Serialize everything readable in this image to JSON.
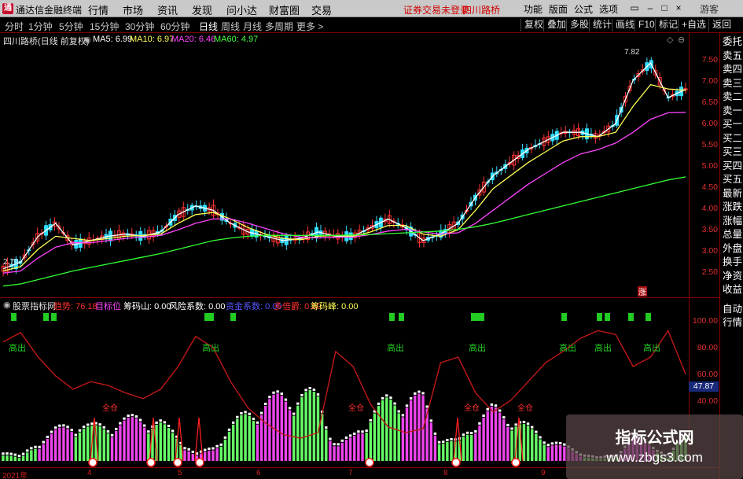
{
  "titlebar": {
    "app_name": "通达信金融终端",
    "menus": [
      "行情",
      "市场",
      "资讯",
      "发现",
      "问小达",
      "财富圈",
      "交易"
    ],
    "notice": "证券交易未登录",
    "stock": "四川路桥",
    "right_menus": [
      "功能",
      "版面",
      "公式",
      "选项"
    ],
    "window_buttons": [
      "▭",
      "–",
      "□",
      "×"
    ]
  },
  "toolbar": {
    "periods": [
      "分时",
      "1分钟",
      "5分钟",
      "15分钟",
      "30分钟",
      "60分钟",
      "日线",
      "周线",
      "月线",
      "多周期",
      "更多 >"
    ],
    "active_period": "日线",
    "right_buttons": [
      "复权",
      "叠加",
      "多股",
      "统计",
      "画线",
      "F10",
      "标记",
      "+自选",
      "返回"
    ]
  },
  "main_chart": {
    "title": "四川路桥(日线 前复权)",
    "indicators": [
      {
        "label": "MA5: 6.99",
        "color": "#ffffff"
      },
      {
        "label": "MA10: 6.97",
        "color": "#ffff55"
      },
      {
        "label": "MA20: 6.46",
        "color": "#ff44ff"
      },
      {
        "label": "MA60: 4.97",
        "color": "#44ff44"
      }
    ],
    "high_label": "7.82",
    "low_label": "2.79",
    "y_ticks": [
      "7.50",
      "7.00",
      "6.50",
      "6.00",
      "5.50",
      "5.00",
      "4.50",
      "4.00",
      "3.50",
      "3.00",
      "2.50"
    ],
    "marker": "涨"
  },
  "sub_chart": {
    "title": "股票指标网",
    "indicators": [
      {
        "label": "趋势: 76.18",
        "color": "#ff3030"
      },
      {
        "label": "目标位",
        "color": "#ff44ff"
      },
      {
        "label": "筹码山: 0.00",
        "color": "#ffffff"
      },
      {
        "label": "风险系数: 0.00",
        "color": "#ffffff"
      },
      {
        "label": "资金系数: 0.00",
        "color": "#5555ff"
      },
      {
        "label": "多倍爵: 0.00",
        "color": "#ff3030"
      },
      {
        "label": "筹码峰: 0.00",
        "color": "#ffff55"
      }
    ],
    "y_ticks": [
      "100.00",
      "80.00",
      "60.00",
      "40.00"
    ],
    "current_value": "47.87",
    "signal_texts": {
      "sell": "高出",
      "buy": "全仓"
    }
  },
  "x_axis": [
    "2021年",
    "4",
    "5",
    "6",
    "7",
    "8",
    "9"
  ],
  "right_panel": [
    "委托",
    "卖五",
    "卖四",
    "卖三",
    "卖二",
    "卖一",
    "买一",
    "买二",
    "买三",
    "买四",
    "买五",
    "最新",
    "涨跌",
    "涨幅",
    "总量",
    "外盘",
    "换手",
    "净资",
    "收益",
    "自动",
    "行情"
  ],
  "watermark": {
    "line1": "指标公式网",
    "line2": "www.zbgs3.com"
  },
  "chart_data": [
    {
      "type": "line",
      "title": "四川路桥(日线 前复权)",
      "ylim": [
        2.3,
        8.0
      ],
      "series": [
        {
          "name": "MA5",
          "values": [
            2.85,
            3.0,
            3.6,
            3.9,
            3.4,
            3.5,
            3.6,
            3.65,
            3.6,
            3.7,
            4.1,
            4.3,
            4.2,
            3.9,
            3.7,
            3.6,
            3.5,
            3.55,
            3.7,
            3.6,
            3.6,
            3.8,
            4.0,
            3.8,
            3.5,
            3.65,
            3.9,
            4.5,
            5.0,
            5.3,
            5.6,
            5.8,
            6.0,
            6.0,
            5.9,
            6.2,
            7.2,
            7.6,
            6.8,
            6.99
          ]
        },
        {
          "name": "MA10",
          "values": [
            2.8,
            2.9,
            3.3,
            3.6,
            3.55,
            3.5,
            3.55,
            3.6,
            3.62,
            3.65,
            3.9,
            4.1,
            4.15,
            4.0,
            3.8,
            3.65,
            3.55,
            3.52,
            3.6,
            3.62,
            3.6,
            3.7,
            3.85,
            3.85,
            3.65,
            3.6,
            3.75,
            4.2,
            4.7,
            5.0,
            5.3,
            5.55,
            5.8,
            5.9,
            5.9,
            6.0,
            6.6,
            7.1,
            7.0,
            6.97
          ]
        },
        {
          "name": "MA20",
          "values": [
            2.75,
            2.8,
            3.1,
            3.35,
            3.45,
            3.45,
            3.5,
            3.55,
            3.58,
            3.62,
            3.75,
            3.9,
            4.0,
            4.0,
            3.9,
            3.78,
            3.66,
            3.58,
            3.56,
            3.58,
            3.58,
            3.64,
            3.72,
            3.76,
            3.7,
            3.65,
            3.68,
            3.9,
            4.2,
            4.5,
            4.8,
            5.05,
            5.3,
            5.5,
            5.6,
            5.75,
            6.0,
            6.3,
            6.45,
            6.46
          ]
        },
        {
          "name": "MA60",
          "values": [
            2.45,
            2.5,
            2.6,
            2.7,
            2.8,
            2.88,
            2.96,
            3.04,
            3.12,
            3.2,
            3.3,
            3.4,
            3.5,
            3.56,
            3.6,
            3.62,
            3.62,
            3.62,
            3.62,
            3.62,
            3.63,
            3.64,
            3.66,
            3.68,
            3.7,
            3.72,
            3.76,
            3.82,
            3.9,
            4.0,
            4.1,
            4.2,
            4.3,
            4.4,
            4.5,
            4.6,
            4.7,
            4.8,
            4.9,
            4.97
          ]
        }
      ]
    },
    {
      "type": "line",
      "title": "股票指标网",
      "ylim": [
        30,
        110
      ],
      "series": [
        {
          "name": "趋势",
          "values": [
            93,
            98,
            85,
            75,
            68,
            72,
            70,
            66,
            63,
            68,
            80,
            96,
            90,
            72,
            58,
            50,
            44,
            42,
            45,
            88,
            80,
            60,
            48,
            45,
            47,
            82,
            85,
            66,
            56,
            62,
            72,
            82,
            88,
            95,
            99,
            97,
            80,
            85,
            99,
            76
          ]
        }
      ]
    }
  ]
}
